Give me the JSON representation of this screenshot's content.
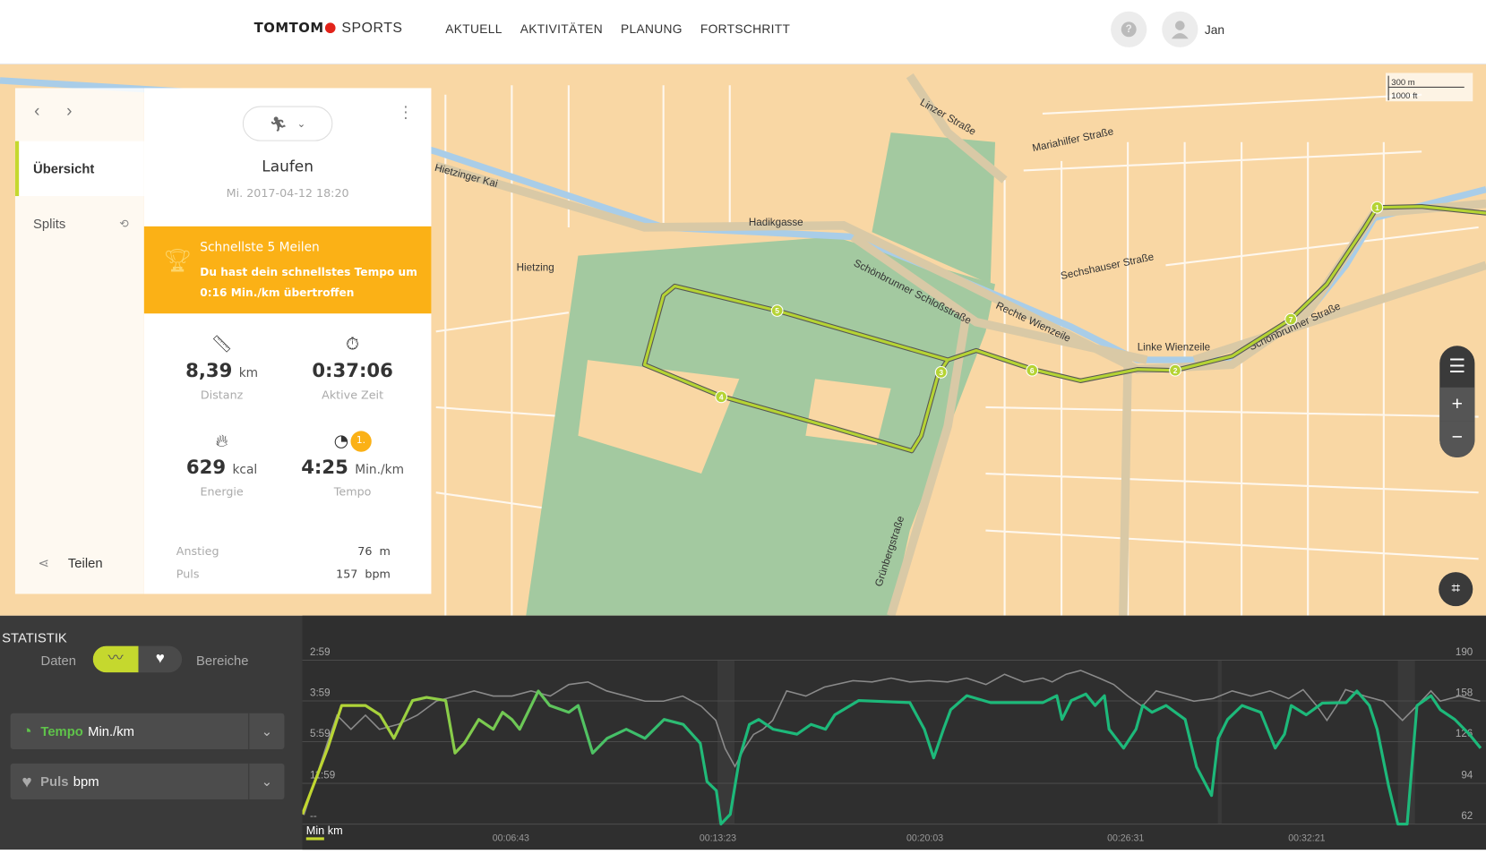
{
  "header": {
    "brand_bold": "TOMTOM",
    "brand_light": "SPORTS",
    "nav": [
      "AKTUELL",
      "AKTIVITÄTEN",
      "PLANUNG",
      "FORTSCHRITT"
    ],
    "user_name": "Jan",
    "help_icon": "question-icon",
    "avatar_icon": "user-icon"
  },
  "map": {
    "scale": {
      "metric": "300 m",
      "imperial": "1000 ft"
    },
    "streets": [
      "Linke Wienzeile",
      "Schönbrunner Schloßstraße",
      "Hadikgasse",
      "Grünbergstraße",
      "Hietzing",
      "Schönbrunner Straße",
      "Rechte Wienzeile",
      "Hietzinger Kai",
      "Linzer Straße",
      "Mariahilfer Straße",
      "Sechshauser Straße"
    ],
    "route_markers": [
      "1",
      "7",
      "2",
      "6",
      "3",
      "4",
      "5"
    ],
    "colors": {
      "land": "#f9d7a4",
      "park": "#a3c9a0",
      "water": "#a9cde8",
      "route": "#b5d334"
    }
  },
  "sidebar": {
    "items": [
      {
        "label": "Übersicht",
        "active": true
      },
      {
        "label": "Splits"
      }
    ],
    "share_label": "Teilen"
  },
  "activity": {
    "title": "Laufen",
    "date": "Mi. 2017-04-12 18:20",
    "achievement": {
      "title": "Schnellste 5 Meilen",
      "text": "Du hast dein schnellstes Tempo um 0:16 Min./km übertroffen"
    },
    "stats": [
      {
        "value": "8,39",
        "unit": "km",
        "label": "Distanz",
        "icon": "ruler-icon"
      },
      {
        "value": "0:37:06",
        "unit": "",
        "label": "Aktive Zeit",
        "icon": "stopwatch-icon"
      },
      {
        "value": "629",
        "unit": "kcal",
        "label": "Energie",
        "icon": "flame-icon"
      },
      {
        "value": "4:25",
        "unit": "Min./km",
        "label": "Tempo",
        "icon": "speedometer-icon",
        "badge": "1."
      }
    ],
    "details": [
      {
        "label": "Anstieg",
        "value": "76",
        "unit": "m"
      },
      {
        "label": "Puls",
        "value": "157",
        "unit": "bpm"
      }
    ]
  },
  "statistics": {
    "title": "STATISTIK",
    "toggle_left": "Daten",
    "toggle_right": "Bereiche",
    "metrics": [
      {
        "name": "Tempo",
        "unit": "Min./km",
        "icon": "speedometer-icon"
      },
      {
        "name": "Puls",
        "unit": "bpm",
        "icon": "heart-icon"
      }
    ],
    "x_unit_active": "Min",
    "x_unit_other": "km"
  },
  "chart_data": {
    "type": "line",
    "x_ticks": [
      "00:06:43",
      "00:13:23",
      "00:20:03",
      "00:26:31",
      "00:32:21"
    ],
    "y_left_ticks": [
      "2:59",
      "3:59",
      "5:59",
      "11:59",
      "--"
    ],
    "y_right_ticks": [
      "190",
      "158",
      "126",
      "94",
      "62"
    ],
    "y_right_range": [
      62,
      190
    ],
    "grid": true,
    "series": [
      {
        "name": "Tempo",
        "unit": "Min./km",
        "color": "#1db97a",
        "color_start": "#c5d82e",
        "points": [
          [
            0,
            "50:00"
          ],
          [
            49,
            "6:27"
          ],
          [
            76,
            "4:08"
          ],
          [
            122,
            "4:08"
          ],
          [
            150,
            "4:29"
          ],
          [
            177,
            "5:43"
          ],
          [
            213,
            "3:58"
          ],
          [
            240,
            "3:52"
          ],
          [
            277,
            "3:58"
          ],
          [
            295,
            "6:54"
          ],
          [
            313,
            "6:04"
          ],
          [
            341,
            "4:41"
          ],
          [
            369,
            "5:10"
          ],
          [
            387,
            "4:23"
          ],
          [
            405,
            "4:41"
          ],
          [
            420,
            "5:10"
          ],
          [
            456,
            "3:41"
          ],
          [
            478,
            "4:08"
          ],
          [
            515,
            "4:23"
          ],
          [
            533,
            "4:08"
          ],
          [
            561,
            "6:54"
          ],
          [
            589,
            "5:43"
          ],
          [
            626,
            "5:10"
          ],
          [
            662,
            "5:43"
          ],
          [
            699,
            "4:41"
          ],
          [
            736,
            "4:55"
          ],
          [
            769,
            "6:04"
          ],
          [
            782,
            "11:32"
          ],
          [
            800,
            "14:38"
          ],
          [
            809,
            "--"
          ],
          [
            827,
            "50:00"
          ],
          [
            845,
            "7:24"
          ],
          [
            864,
            "4:55"
          ],
          [
            882,
            "4:41"
          ],
          [
            910,
            "5:10"
          ],
          [
            956,
            "5:27"
          ],
          [
            983,
            "4:55"
          ],
          [
            1011,
            "5:10"
          ],
          [
            1029,
            "4:29"
          ],
          [
            1075,
            "3:58"
          ],
          [
            1174,
            "4:02"
          ],
          [
            1202,
            "5:10"
          ],
          [
            1220,
            "7:24"
          ],
          [
            1239,
            "5:10"
          ],
          [
            1253,
            "4:17"
          ],
          [
            1284,
            "3:49"
          ],
          [
            1330,
            "4:02"
          ],
          [
            1431,
            "4:02"
          ],
          [
            1458,
            "3:49"
          ],
          [
            1468,
            "4:41"
          ],
          [
            1486,
            "3:58"
          ],
          [
            1514,
            "3:46"
          ],
          [
            1532,
            "4:08"
          ],
          [
            1550,
            "3:49"
          ],
          [
            1559,
            "5:10"
          ],
          [
            1587,
            "6:27"
          ],
          [
            1611,
            "5:10"
          ],
          [
            1624,
            "4:08"
          ],
          [
            1642,
            "4:23"
          ],
          [
            1669,
            "4:08"
          ],
          [
            1706,
            "4:41"
          ],
          [
            1728,
            "8:34"
          ],
          [
            1757,
            "17:09"
          ],
          [
            1770,
            "5:43"
          ],
          [
            1788,
            "4:41"
          ],
          [
            1816,
            "4:08"
          ],
          [
            1852,
            "4:23"
          ],
          [
            1880,
            "6:27"
          ],
          [
            1898,
            "5:27"
          ],
          [
            1911,
            "4:08"
          ],
          [
            1940,
            "4:29"
          ],
          [
            1971,
            "4:03"
          ],
          [
            2017,
            "4:02"
          ],
          [
            2038,
            "3:41"
          ],
          [
            2062,
            "4:08"
          ],
          [
            2077,
            "5:10"
          ],
          [
            2099,
            "12:46"
          ],
          [
            2117,
            "--"
          ],
          [
            2135,
            "--"
          ],
          [
            2154,
            "4:08"
          ],
          [
            2181,
            "3:49"
          ],
          [
            2199,
            "4:17"
          ],
          [
            2227,
            "4:41"
          ],
          [
            2255,
            "5:27"
          ],
          [
            2277,
            "6:27"
          ]
        ]
      },
      {
        "name": "Puls",
        "unit": "bpm",
        "color": "#8a8a8a",
        "points": [
          [
            3,
            69
          ],
          [
            48,
            125
          ],
          [
            67,
            147
          ],
          [
            94,
            136
          ],
          [
            122,
            147
          ],
          [
            149,
            136
          ],
          [
            186,
            140
          ],
          [
            222,
            147
          ],
          [
            259,
            158
          ],
          [
            296,
            162
          ],
          [
            332,
            166
          ],
          [
            369,
            162
          ],
          [
            405,
            162
          ],
          [
            442,
            166
          ],
          [
            479,
            162
          ],
          [
            515,
            171
          ],
          [
            552,
            173
          ],
          [
            588,
            166
          ],
          [
            625,
            162
          ],
          [
            662,
            158
          ],
          [
            698,
            158
          ],
          [
            735,
            162
          ],
          [
            771,
            154
          ],
          [
            799,
            143
          ],
          [
            817,
            121
          ],
          [
            836,
            107
          ],
          [
            854,
            121
          ],
          [
            872,
            132
          ],
          [
            890,
            136
          ],
          [
            909,
            143
          ],
          [
            936,
            166
          ],
          [
            973,
            162
          ],
          [
            1009,
            169
          ],
          [
            1064,
            174
          ],
          [
            1101,
            173
          ],
          [
            1138,
            176
          ],
          [
            1174,
            173
          ],
          [
            1211,
            174
          ],
          [
            1247,
            173
          ],
          [
            1284,
            176
          ],
          [
            1321,
            171
          ],
          [
            1357,
            179
          ],
          [
            1394,
            173
          ],
          [
            1431,
            176
          ],
          [
            1449,
            173
          ],
          [
            1476,
            179
          ],
          [
            1504,
            182
          ],
          [
            1540,
            176
          ],
          [
            1568,
            171
          ],
          [
            1595,
            162
          ],
          [
            1623,
            154
          ],
          [
            1650,
            166
          ],
          [
            1687,
            162
          ],
          [
            1723,
            158
          ],
          [
            1760,
            160
          ],
          [
            1797,
            166
          ],
          [
            1833,
            162
          ],
          [
            1870,
            166
          ],
          [
            1906,
            160
          ],
          [
            1934,
            167
          ],
          [
            1961,
            154
          ],
          [
            1980,
            143
          ],
          [
            1998,
            154
          ],
          [
            2016,
            167
          ],
          [
            2053,
            162
          ],
          [
            2089,
            158
          ],
          [
            2126,
            143
          ],
          [
            2153,
            154
          ],
          [
            2181,
            166
          ],
          [
            2199,
            158
          ],
          [
            2236,
            162
          ],
          [
            2276,
            158
          ]
        ]
      }
    ]
  }
}
